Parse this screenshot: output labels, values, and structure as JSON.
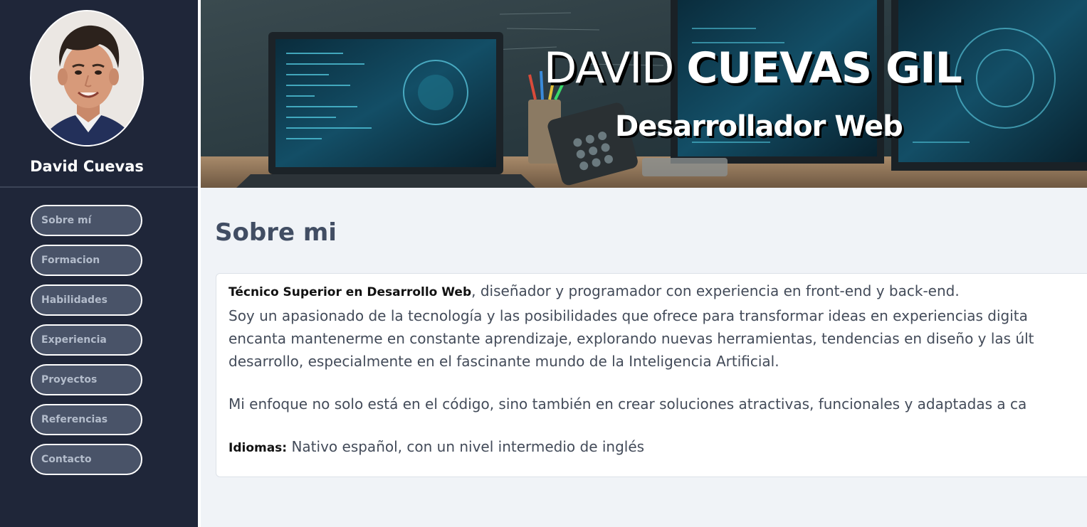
{
  "profile": {
    "name": "David Cuevas"
  },
  "nav": {
    "items": [
      {
        "label": "Sobre mí"
      },
      {
        "label": "Formacion"
      },
      {
        "label": "Habilidades"
      },
      {
        "label": "Experiencia"
      },
      {
        "label": "Proyectos"
      },
      {
        "label": "Referencias"
      },
      {
        "label": "Contacto"
      }
    ]
  },
  "header": {
    "title_first": "DAVID",
    "title_last": "CUEVAS GIL",
    "subtitle": "Desarrollador Web"
  },
  "about": {
    "title": "Sobre mi",
    "role_bold": "Técnico Superior en Desarrollo Web",
    "role_rest": ", diseñador y programador con experiencia en front-end y back-end.",
    "paragraph1_line1": "Soy un apasionado de la tecnología y las posibilidades que ofrece para transformar ideas en experiencias digita",
    "paragraph1_line2": "encanta mantenerme en constante aprendizaje, explorando nuevas herramientas, tendencias en diseño y las últ",
    "paragraph1_line3": "desarrollo, especialmente en el fascinante mundo de la Inteligencia Artificial.",
    "paragraph2": "Mi enfoque no solo está en el código, sino también en crear soluciones atractivas, funcionales y adaptadas a ca",
    "languages_label": "Idiomas:",
    "languages_value": " Nativo español, con un nivel intermedio de inglés"
  },
  "colors": {
    "sidebar_bg": "#1f2639",
    "nav_button_bg": "#495368",
    "nav_button_text": "#b3bccb",
    "page_bg": "#f0f3f7",
    "section_title": "#414d63"
  }
}
